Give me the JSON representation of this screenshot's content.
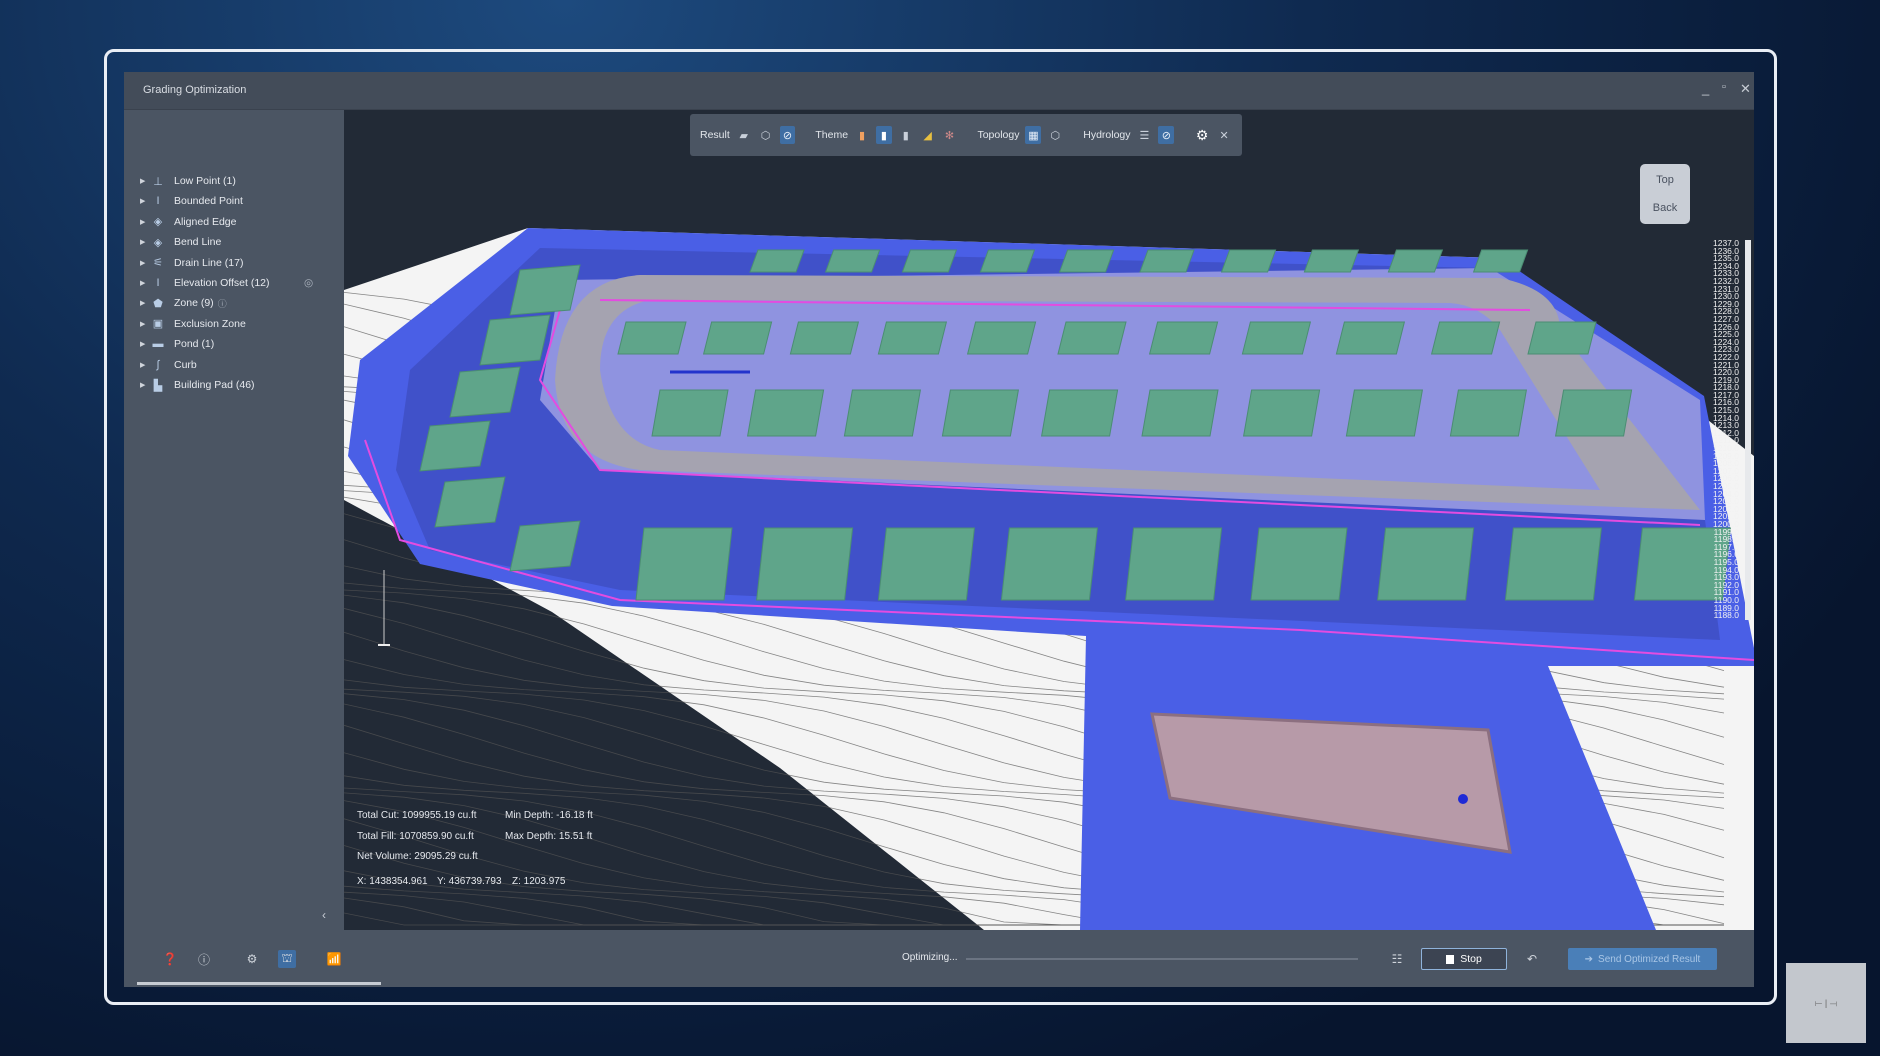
{
  "window": {
    "title": "Grading Optimization",
    "controls": [
      "_",
      "▫",
      "✕"
    ]
  },
  "sidebar": {
    "items": [
      {
        "label": "Low Point (1)",
        "icon": "low-point-icon",
        "glyph": "⊥"
      },
      {
        "label": "Bounded Point",
        "icon": "bounded-point-icon",
        "glyph": "I"
      },
      {
        "label": "Aligned Edge",
        "icon": "aligned-edge-icon",
        "glyph": "◈"
      },
      {
        "label": "Bend Line",
        "icon": "bend-line-icon",
        "glyph": "◈"
      },
      {
        "label": "Drain Line (17)",
        "icon": "drain-line-icon",
        "glyph": "⚟"
      },
      {
        "label": "Elevation Offset (12)",
        "icon": "elevation-offset-icon",
        "glyph": "I"
      },
      {
        "label": "Zone (9)",
        "icon": "zone-icon",
        "glyph": "⬟"
      },
      {
        "label": "Exclusion Zone",
        "icon": "exclusion-zone-icon",
        "glyph": "▣"
      },
      {
        "label": "Pond (1)",
        "icon": "pond-icon",
        "glyph": "▬"
      },
      {
        "label": "Curb",
        "icon": "curb-icon",
        "glyph": "∫"
      },
      {
        "label": "Building Pad (46)",
        "icon": "building-pad-icon",
        "glyph": "▙"
      }
    ]
  },
  "toolbar": {
    "result": "Result",
    "theme": "Theme",
    "topology": "Topology",
    "hydrology": "Hydrology"
  },
  "navcube": {
    "top": "Top",
    "back": "Back"
  },
  "stats": {
    "total_cut": "Total Cut: 1099955.19 cu.ft",
    "min_depth": "Min Depth: -16.18 ft",
    "total_fill": "Total Fill: 1070859.90 cu.ft",
    "max_depth": "Max Depth: 15.51 ft",
    "net_volume": "Net Volume: 29095.29 cu.ft",
    "x": "X: 1438354.961",
    "y": "Y: 436739.793",
    "z": "Z: 1203.975"
  },
  "elevation_scale": [
    "1237.0",
    "1236.0",
    "1235.0",
    "1234.0",
    "1233.0",
    "1232.0",
    "1231.0",
    "1230.0",
    "1229.0",
    "1228.0",
    "1227.0",
    "1226.0",
    "1225.0",
    "1224.0",
    "1223.0",
    "1222.0",
    "1221.0",
    "1220.0",
    "1219.0",
    "1218.0",
    "1217.0",
    "1216.0",
    "1215.0",
    "1214.0",
    "1213.0",
    "1212.0",
    "1211.0",
    "1210.0",
    "1209.0",
    "1208.0",
    "1207.0",
    "1206.0",
    "1205.0",
    "1204.0",
    "1203.0",
    "1202.0",
    "1201.0",
    "1200.0",
    "1199.0",
    "1198.0",
    "1197.0",
    "1196.0",
    "1195.0",
    "1194.0",
    "1193.0",
    "1192.0",
    "1191.0",
    "1190.0",
    "1189.0",
    "1188.0"
  ],
  "bottom": {
    "status": "Optimizing...",
    "progress": 0.0,
    "stop": "Stop",
    "send": "Send Optimized Result"
  },
  "colors": {
    "site_blue": "#4a5fe6",
    "pad_green": "#5fa58a",
    "road_gray": "#a5a3b0",
    "pond_pink": "#b79aa8",
    "drain_magenta": "#e34ce0"
  }
}
